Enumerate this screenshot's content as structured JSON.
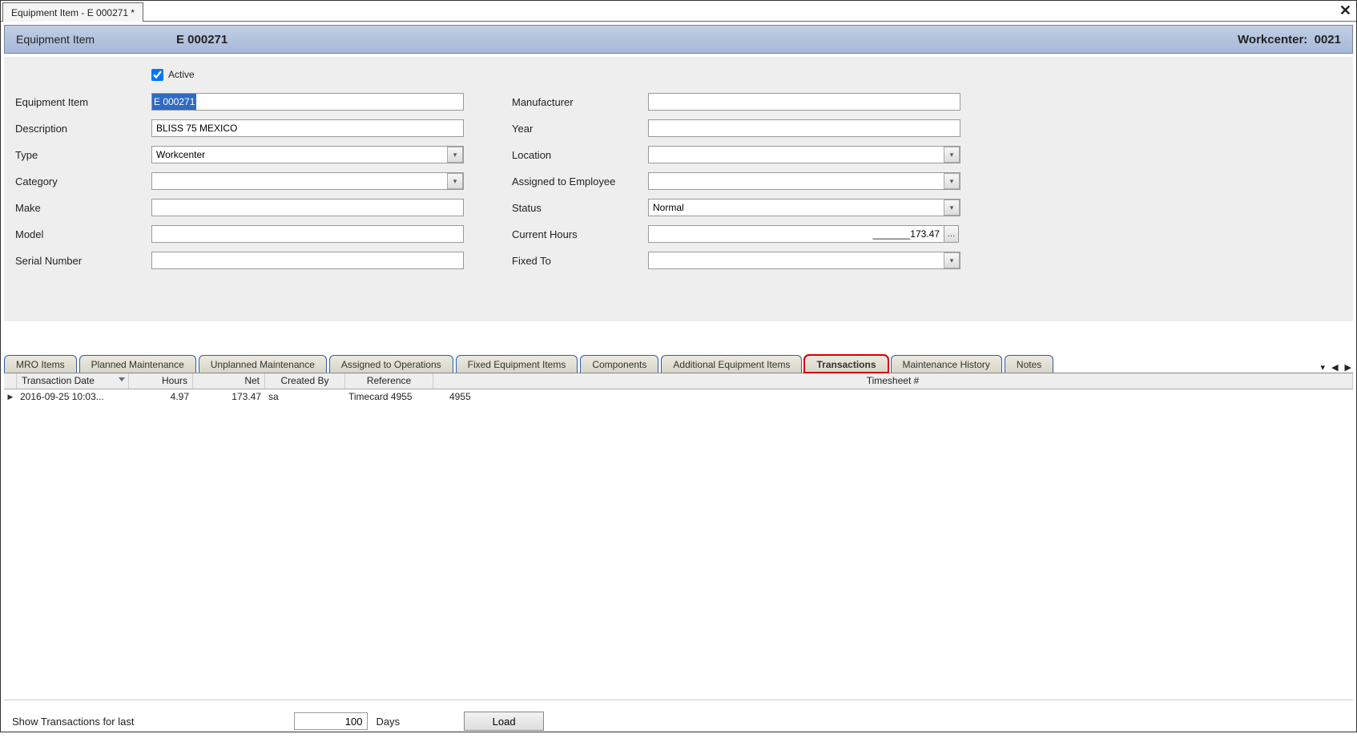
{
  "windowTab": "Equipment Item - E 000271 *",
  "header": {
    "title": "Equipment Item",
    "id": "E 000271",
    "workcenterLabel": "Workcenter:",
    "workcenterId": "0021"
  },
  "form": {
    "activeLabel": "Active",
    "activeChecked": true,
    "left": {
      "equipmentItemLabel": "Equipment Item",
      "equipmentItemValue": "E 000271",
      "descriptionLabel": "Description",
      "descriptionValue": "BLISS 75 MEXICO",
      "typeLabel": "Type",
      "typeValue": "Workcenter",
      "categoryLabel": "Category",
      "categoryValue": "",
      "makeLabel": "Make",
      "makeValue": "",
      "modelLabel": "Model",
      "modelValue": "",
      "serialLabel": "Serial Number",
      "serialValue": ""
    },
    "right": {
      "manufacturerLabel": "Manufacturer",
      "manufacturerValue": "",
      "yearLabel": "Year",
      "yearValue": "",
      "locationLabel": "Location",
      "locationValue": "",
      "assignedLabel": "Assigned to Employee",
      "assignedValue": "",
      "statusLabel": "Status",
      "statusValue": "Normal",
      "currentHoursLabel": "Current Hours",
      "currentHoursValue": "_______173.47",
      "fixedToLabel": "Fixed To",
      "fixedToValue": ""
    }
  },
  "tabs": {
    "items": [
      "MRO Items",
      "Planned Maintenance",
      "Unplanned Maintenance",
      "Assigned to Operations",
      "Fixed Equipment Items",
      "Components",
      "Additional Equipment Items",
      "Transactions",
      "Maintenance History",
      "Notes"
    ],
    "activeIndex": 7
  },
  "grid": {
    "headers": {
      "date": "Transaction Date",
      "hours": "Hours",
      "net": "Net",
      "createdBy": "Created By",
      "reference": "Reference",
      "timesheet": "Timesheet #"
    },
    "rows": [
      {
        "date": "2016-09-25  10:03...",
        "hours": "4.97",
        "net": "173.47",
        "createdBy": "sa",
        "reference": "Timecard 4955",
        "timesheet": "4955"
      }
    ]
  },
  "bottom": {
    "label": "Show Transactions for last",
    "daysValue": "100",
    "daysLabel": "Days",
    "loadLabel": "Load"
  }
}
